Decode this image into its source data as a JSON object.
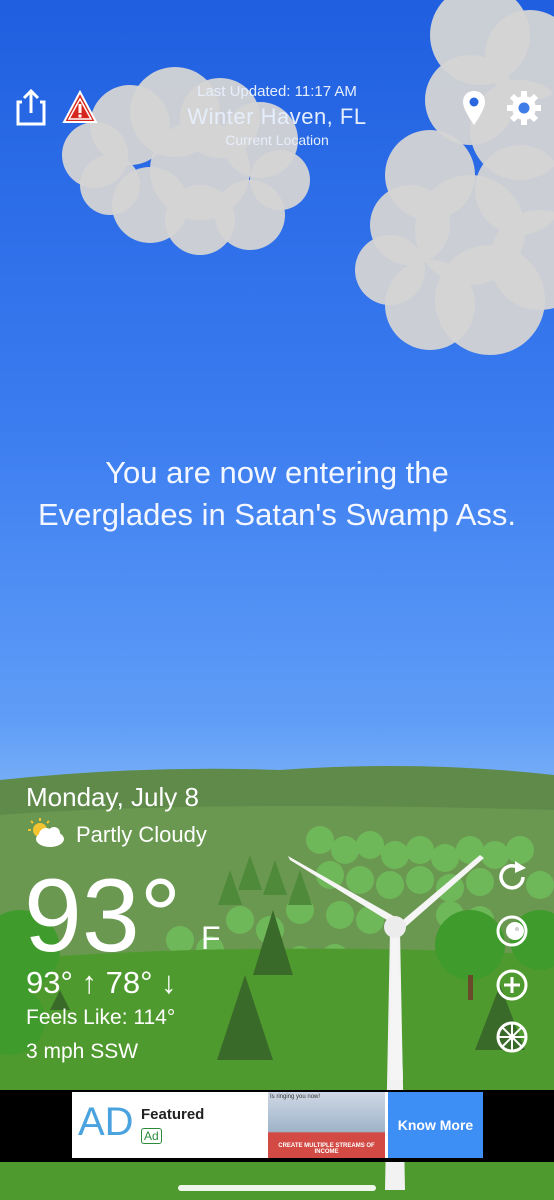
{
  "header": {
    "last_updated": "Last Updated: 11:17 AM",
    "city": "Winter Haven, FL",
    "location_sub": "Current Location"
  },
  "message": "You are now entering the Everglades in Satan's Swamp Ass.",
  "weather": {
    "date": "Monday, July 8",
    "condition": "Partly Cloudy",
    "temperature": "93°",
    "unit": "F",
    "hi_lo": "93° ↑  78° ↓",
    "feels_like": "Feels Like: 114°",
    "wind": "3 mph SSW"
  },
  "icons": {
    "share": "share-icon",
    "alert": "alert-icon",
    "location": "location-pin-icon",
    "settings": "gear-icon",
    "refresh": "refresh-icon",
    "moon": "moon-icon",
    "add": "add-icon",
    "wheel": "wheel-icon"
  },
  "ad": {
    "logo": "AD",
    "featured": "Featured",
    "badge": "Ad",
    "image_top": "Is ringing you now!",
    "image_caption": "CREATE MULTIPLE STREAMS OF INCOME",
    "cta": "Know More"
  },
  "colors": {
    "sky_top": "#1f5fe0",
    "sky_mid": "#5f9df7",
    "grass": "#4f9a2e",
    "hills": "#5f8a4a",
    "ad_button": "#3d8ef5"
  }
}
